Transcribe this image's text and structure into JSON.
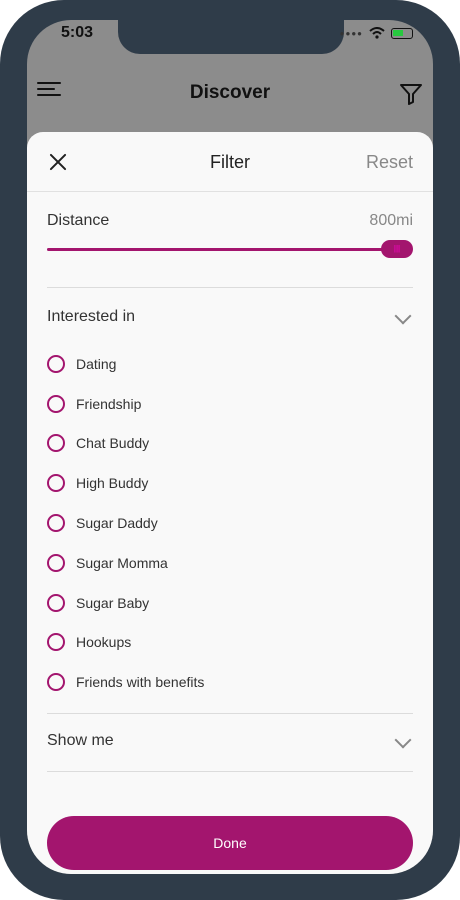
{
  "status_bar": {
    "time": "5:03"
  },
  "header": {
    "title": "Discover"
  },
  "filter": {
    "title": "Filter",
    "reset_label": "Reset",
    "distance": {
      "label": "Distance",
      "value_text": "800mi",
      "fill_fraction": 0.92
    },
    "interested_in": {
      "label": "Interested in",
      "options": [
        "Dating",
        "Friendship",
        "Chat Buddy",
        "High Buddy",
        "Sugar Daddy",
        "Sugar Momma",
        "Sugar Baby",
        "Hookups",
        "Friends with benefits"
      ]
    },
    "show_me": {
      "label": "Show me"
    },
    "done_label": "Done"
  },
  "colors": {
    "accent": "#a3156e",
    "frame": "#2f3c49"
  }
}
